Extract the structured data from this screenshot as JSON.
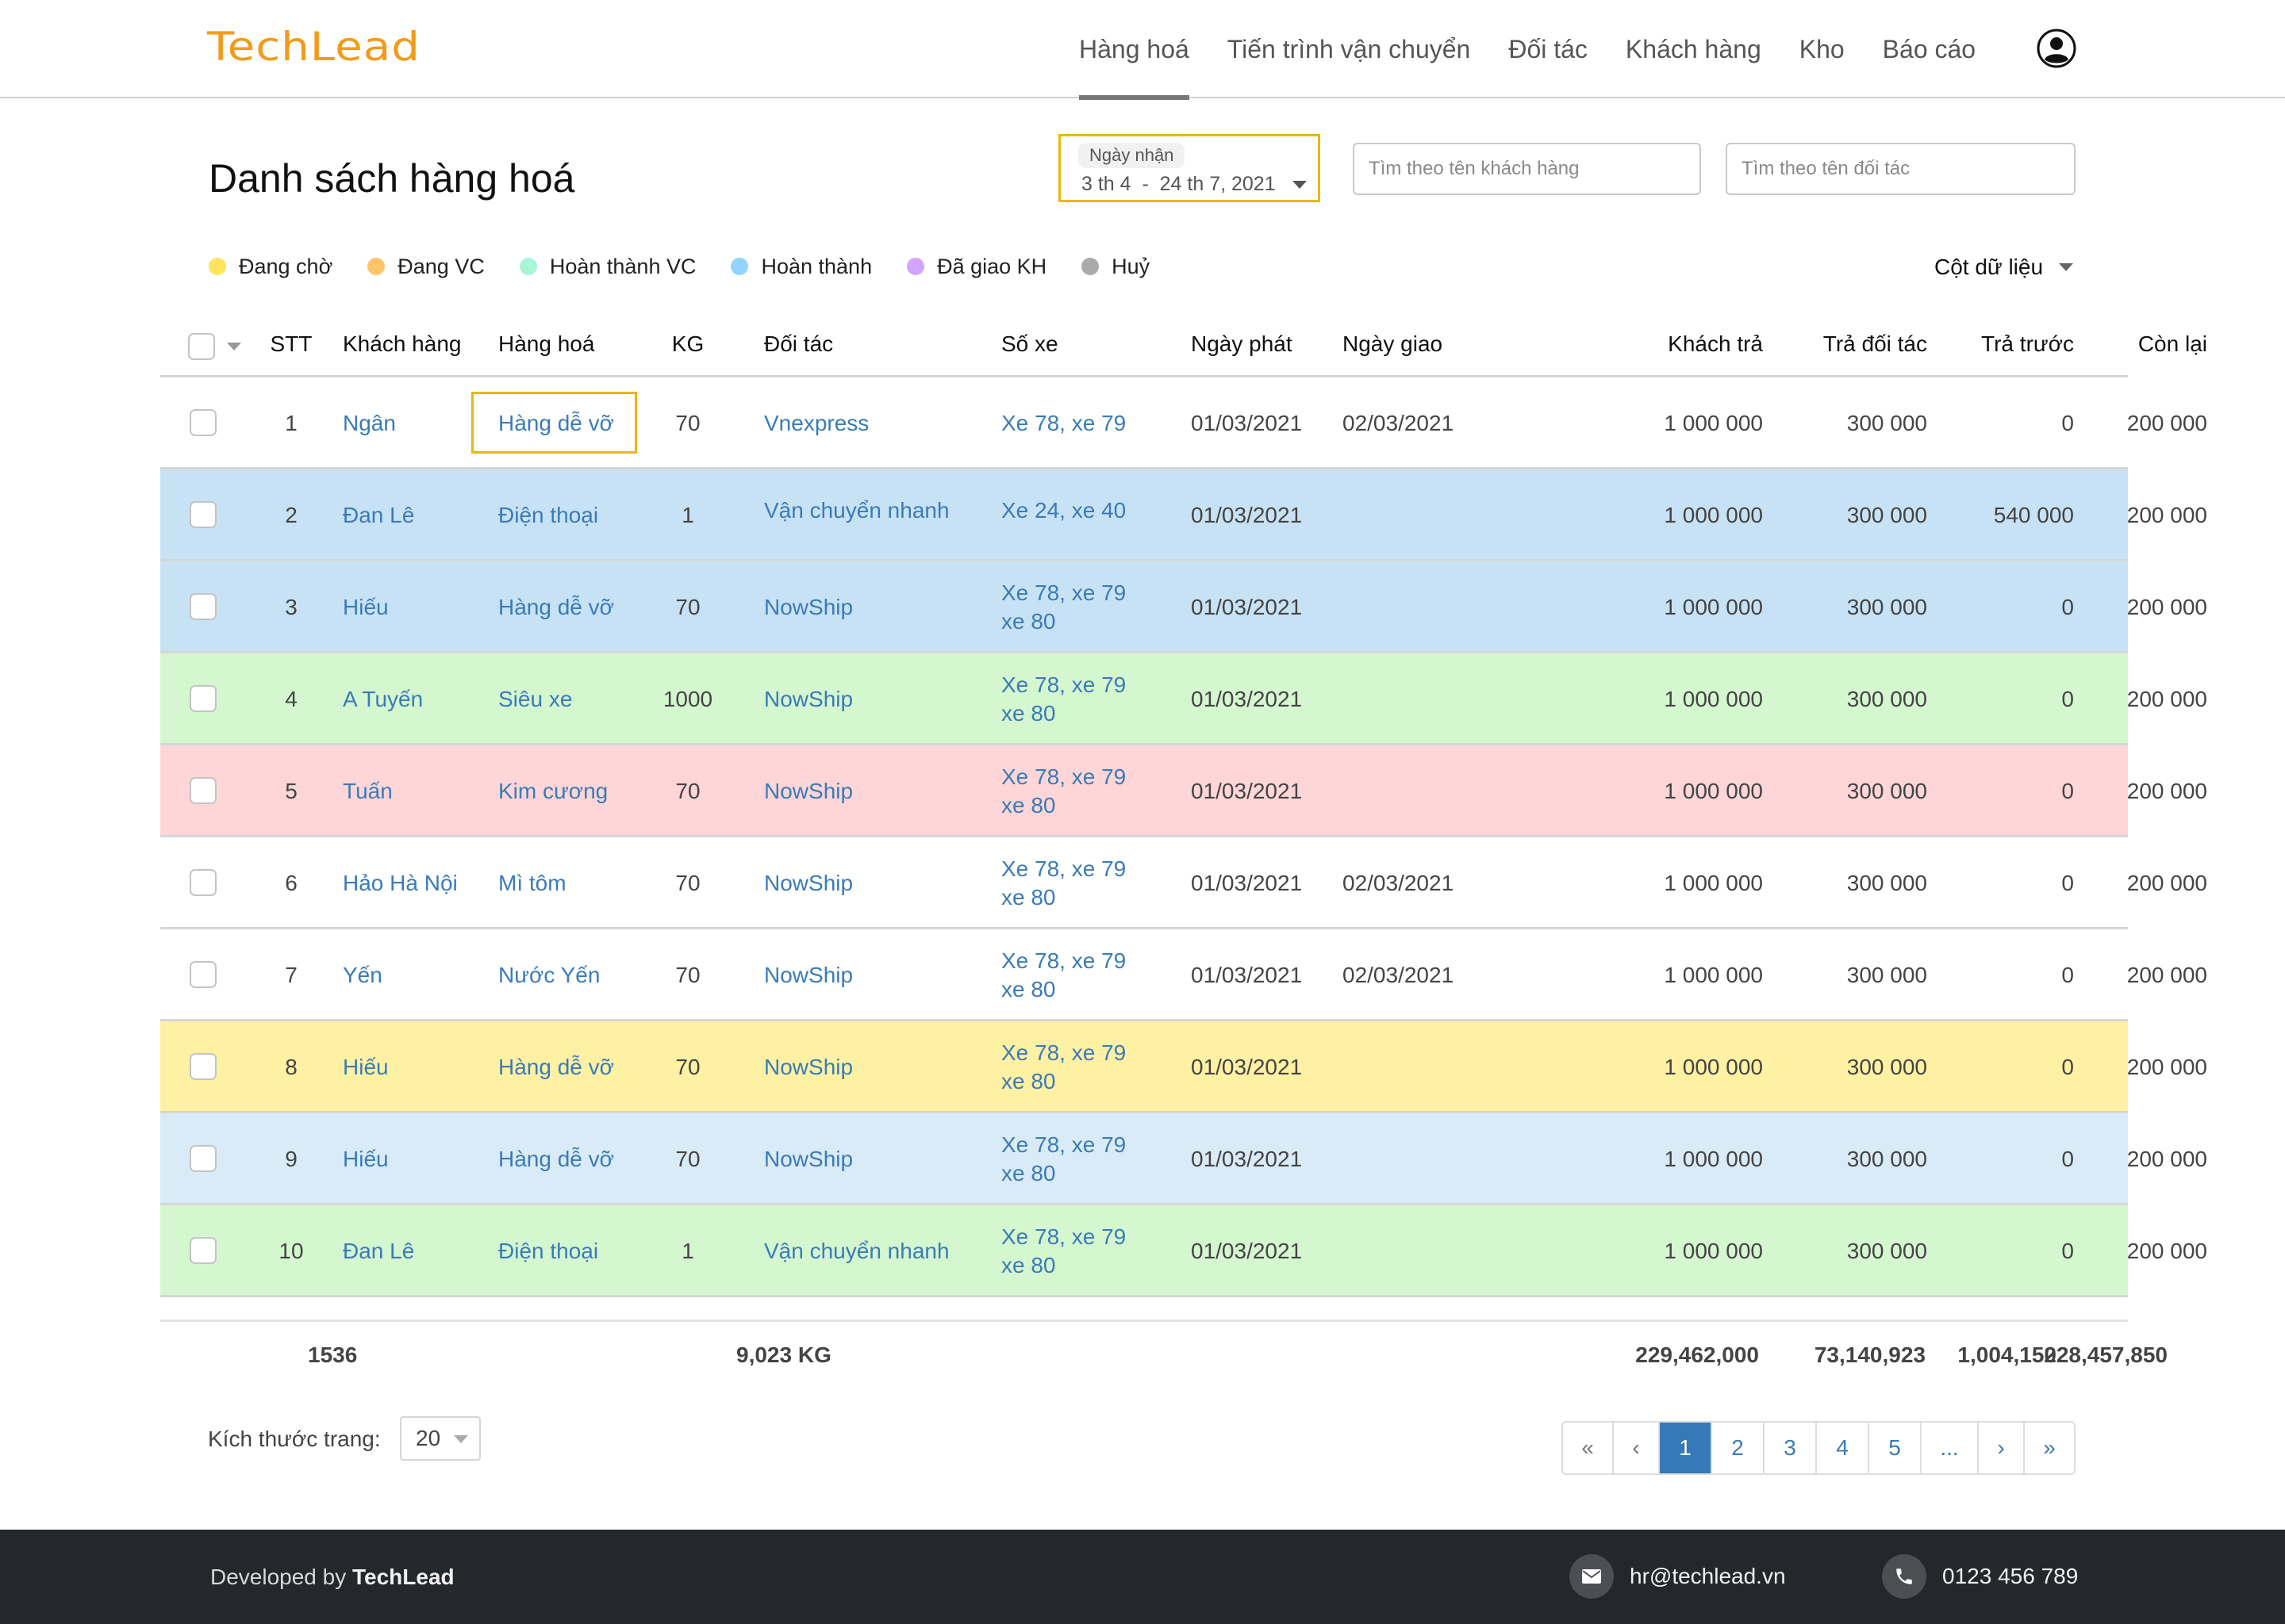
{
  "header": {
    "logo": "TechLead",
    "nav": [
      {
        "label": "Hàng hoá",
        "active": true
      },
      {
        "label": "Tiến trình vận chuyển",
        "active": false
      },
      {
        "label": "Đối tác",
        "active": false
      },
      {
        "label": "Khách hàng",
        "active": false
      },
      {
        "label": "Kho",
        "active": false
      },
      {
        "label": "Báo cáo",
        "active": false
      }
    ],
    "user_icon": "user-circle-icon"
  },
  "page": {
    "title": "Danh sách hàng hoá",
    "date_filter": {
      "label": "Ngày nhận",
      "value": "3 th 4  -  24 th 7, 2021"
    },
    "search_customer": {
      "placeholder": "Tìm theo tên khách hàng",
      "value": ""
    },
    "search_partner": {
      "placeholder": "Tìm theo tên đối tác",
      "value": ""
    },
    "columns_toggle": "Cột dữ liệu"
  },
  "legend": [
    {
      "label": "Đang chờ",
      "color": "#ffe45c"
    },
    {
      "label": "Đang VC",
      "color": "#ffc46b"
    },
    {
      "label": "Hoàn thành VC",
      "color": "#a8f5d8"
    },
    {
      "label": "Hoàn thành",
      "color": "#93d3ff"
    },
    {
      "label": "Đã giao KH",
      "color": "#d3a4ff"
    },
    {
      "label": "Huỷ",
      "color": "#aaaaaa"
    }
  ],
  "table": {
    "columns": [
      "STT",
      "Khách hàng",
      "Hàng hoá",
      "KG",
      "Đối tác",
      "Số xe",
      "Ngày phát",
      "Ngày giao",
      "Khách trả",
      "Trả đối tác",
      "Trả trước",
      "Còn lại"
    ],
    "rows": [
      {
        "stt": "1",
        "customer": "Ngân",
        "goods": "Hàng dễ vỡ",
        "kg": "70",
        "partner": "Vnexpress",
        "plates": [
          "Xe 78, xe 79"
        ],
        "ship_date": "01/03/2021",
        "delivery_date": "02/03/2021",
        "customer_pay": "1 000 000",
        "partner_pay": "300 000",
        "prepaid": "0",
        "remaining": "200 000",
        "bg": "#ffffff",
        "highlight_goods": true
      },
      {
        "stt": "2",
        "customer": "Đan Lê",
        "goods": "Điện thoại",
        "kg": "1",
        "partner": "Vận chuyển nhanh",
        "plates": [
          "Xe 24, xe 40"
        ],
        "ship_date": "01/03/2021",
        "delivery_date": "",
        "customer_pay": "1 000 000",
        "partner_pay": "300 000",
        "prepaid": "540 000",
        "remaining": "200 000",
        "bg": "#c8e2f5"
      },
      {
        "stt": "3",
        "customer": "Hiếu",
        "goods": "Hàng dễ vỡ",
        "kg": "70",
        "partner": "NowShip",
        "plates": [
          "Xe 78, xe 79",
          "xe 80"
        ],
        "ship_date": "01/03/2021",
        "delivery_date": "",
        "customer_pay": "1 000 000",
        "partner_pay": "300 000",
        "prepaid": "0",
        "remaining": "200 000",
        "bg": "#c8e2f5"
      },
      {
        "stt": "4",
        "customer": "A Tuyến",
        "goods": "Siêu xe",
        "kg": "1000",
        "partner": "NowShip",
        "plates": [
          "Xe 78, xe 79",
          "xe 80"
        ],
        "ship_date": "01/03/2021",
        "delivery_date": "",
        "customer_pay": "1 000 000",
        "partner_pay": "300 000",
        "prepaid": "0",
        "remaining": "200 000",
        "bg": "#d5f7d0"
      },
      {
        "stt": "5",
        "customer": "Tuấn",
        "goods": "Kim cương",
        "kg": "70",
        "partner": "NowShip",
        "plates": [
          "Xe 78, xe 79",
          "xe 80"
        ],
        "ship_date": "01/03/2021",
        "delivery_date": "",
        "customer_pay": "1 000 000",
        "partner_pay": "300 000",
        "prepaid": "0",
        "remaining": "200 000",
        "bg": "#ffd6d7"
      },
      {
        "stt": "6",
        "customer": "Hảo Hà Nội",
        "goods": "Mì tôm",
        "kg": "70",
        "partner": "NowShip",
        "plates": [
          "Xe 78, xe 79",
          "xe 80"
        ],
        "ship_date": "01/03/2021",
        "delivery_date": "02/03/2021",
        "customer_pay": "1 000 000",
        "partner_pay": "300 000",
        "prepaid": "0",
        "remaining": "200 000",
        "bg": "#ffffff"
      },
      {
        "stt": "7",
        "customer": "Yến",
        "goods": "Nước Yến",
        "kg": "70",
        "partner": "NowShip",
        "plates": [
          "Xe 78, xe 79",
          "xe 80"
        ],
        "ship_date": "01/03/2021",
        "delivery_date": "02/03/2021",
        "customer_pay": "1 000 000",
        "partner_pay": "300 000",
        "prepaid": "0",
        "remaining": "200 000",
        "bg": "#ffffff"
      },
      {
        "stt": "8",
        "customer": "Hiếu",
        "goods": "Hàng dễ vỡ",
        "kg": "70",
        "partner": "NowShip",
        "plates": [
          "Xe 78, xe 79",
          "xe 80"
        ],
        "ship_date": "01/03/2021",
        "delivery_date": "",
        "customer_pay": "1 000 000",
        "partner_pay": "300 000",
        "prepaid": "0",
        "remaining": "200 000",
        "bg": "#fff1a3"
      },
      {
        "stt": "9",
        "customer": "Hiếu",
        "goods": "Hàng dễ vỡ",
        "kg": "70",
        "partner": "NowShip",
        "plates": [
          "Xe 78, xe 79",
          "xe 80"
        ],
        "ship_date": "01/03/2021",
        "delivery_date": "",
        "customer_pay": "1 000 000",
        "partner_pay": "300 000",
        "prepaid": "0",
        "remaining": "200 000",
        "bg": "#d9ebf6"
      },
      {
        "stt": "10",
        "customer": "Đan Lê",
        "goods": "Điện thoại",
        "kg": "1",
        "partner": "Vận chuyển nhanh",
        "plates": [
          "Xe 78, xe 79",
          "xe 80"
        ],
        "ship_date": "01/03/2021",
        "delivery_date": "",
        "customer_pay": "1 000 000",
        "partner_pay": "300 000",
        "prepaid": "0",
        "remaining": "200 000",
        "bg": "#d5f7d0"
      }
    ],
    "totals": {
      "count": "1536",
      "kg": "9,023 KG",
      "customer_pay": "229,462,000",
      "partner_pay": "73,140,923",
      "prepaid": "1,004,150",
      "remaining": "228,457,850"
    }
  },
  "pagination": {
    "page_size_label": "Kích thước trang:",
    "page_size": "20",
    "first": "«",
    "prev": "‹",
    "pages": [
      "1",
      "2",
      "3",
      "4",
      "5",
      "..."
    ],
    "current": "1",
    "next": "›",
    "last": "»"
  },
  "footer": {
    "developed_by_prefix": "Developed by",
    "developed_by_brand": "TechLead",
    "email": "hr@techlead.vn",
    "phone": "0123 456 789"
  }
}
